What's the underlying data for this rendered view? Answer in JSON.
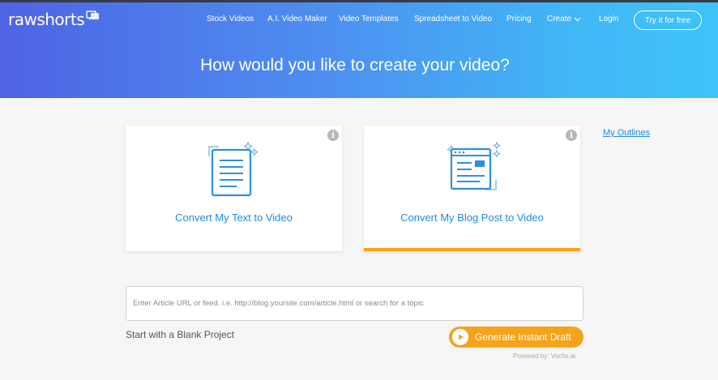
{
  "header": {
    "logo_text": "rawshorts",
    "nav": {
      "stock_videos": "Stock Videos",
      "ai_video_maker": "A.I. Video Maker",
      "video_templates": "Video Templates",
      "spreadsheet_to_video": "Spreadsheet to Video",
      "pricing": "Pricing",
      "create": "Create",
      "login": "Login",
      "try_free": "Try it for free"
    },
    "title": "How would you like to create your video?"
  },
  "cards": {
    "text_to_video": {
      "label": "Convert My Text to Video",
      "info": "i",
      "icon": "document-icon"
    },
    "blog_to_video": {
      "label": "Convert My Blog Post to Video",
      "info": "i",
      "icon": "webpage-icon",
      "selected": true
    }
  },
  "sidebar": {
    "my_outlines": "My Outlines"
  },
  "form": {
    "url_placeholder": "Enter Article URL or feed. i.e. http://blog.yoursite.com/article.html or search for a topic",
    "url_value": "",
    "blank_project": "Start with a Blank Project",
    "generate_label": "Generate Instant Draft",
    "powered_by": "Powered by: Vocfio.ai"
  },
  "colors": {
    "accent_blue": "#1f8be5",
    "accent_orange": "#f5a31a",
    "hero_start": "#4f63e4",
    "hero_end": "#3ec3f8"
  }
}
